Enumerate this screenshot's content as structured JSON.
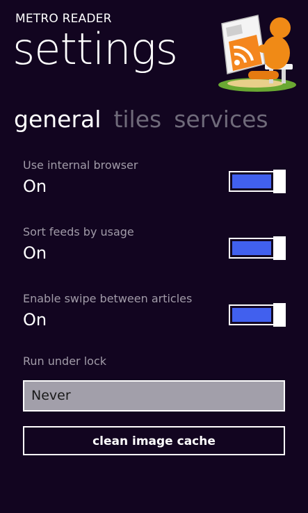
{
  "app": {
    "title": "METRO READER",
    "page_title": "settings",
    "logo_icon": "rss-reader-mascot-icon"
  },
  "pivot": {
    "items": [
      {
        "label": "general",
        "active": true
      },
      {
        "label": "tiles",
        "active": false
      },
      {
        "label": "services",
        "active": false
      }
    ]
  },
  "settings": [
    {
      "label": "Use internal browser",
      "value": "On"
    },
    {
      "label": "Sort feeds by usage",
      "value": "On"
    },
    {
      "label": "Enable swipe between articles",
      "value": "On"
    }
  ],
  "run_under_lock": {
    "label": "Run under lock",
    "selected": "Never"
  },
  "actions": {
    "clean_cache_label": "clean image cache"
  },
  "colors": {
    "background": "#120520",
    "accent": "#4160ee",
    "secondary_text": "#a19ba8",
    "inactive_pivot": "#6f6a7a",
    "picker_background": "#a29faa"
  }
}
